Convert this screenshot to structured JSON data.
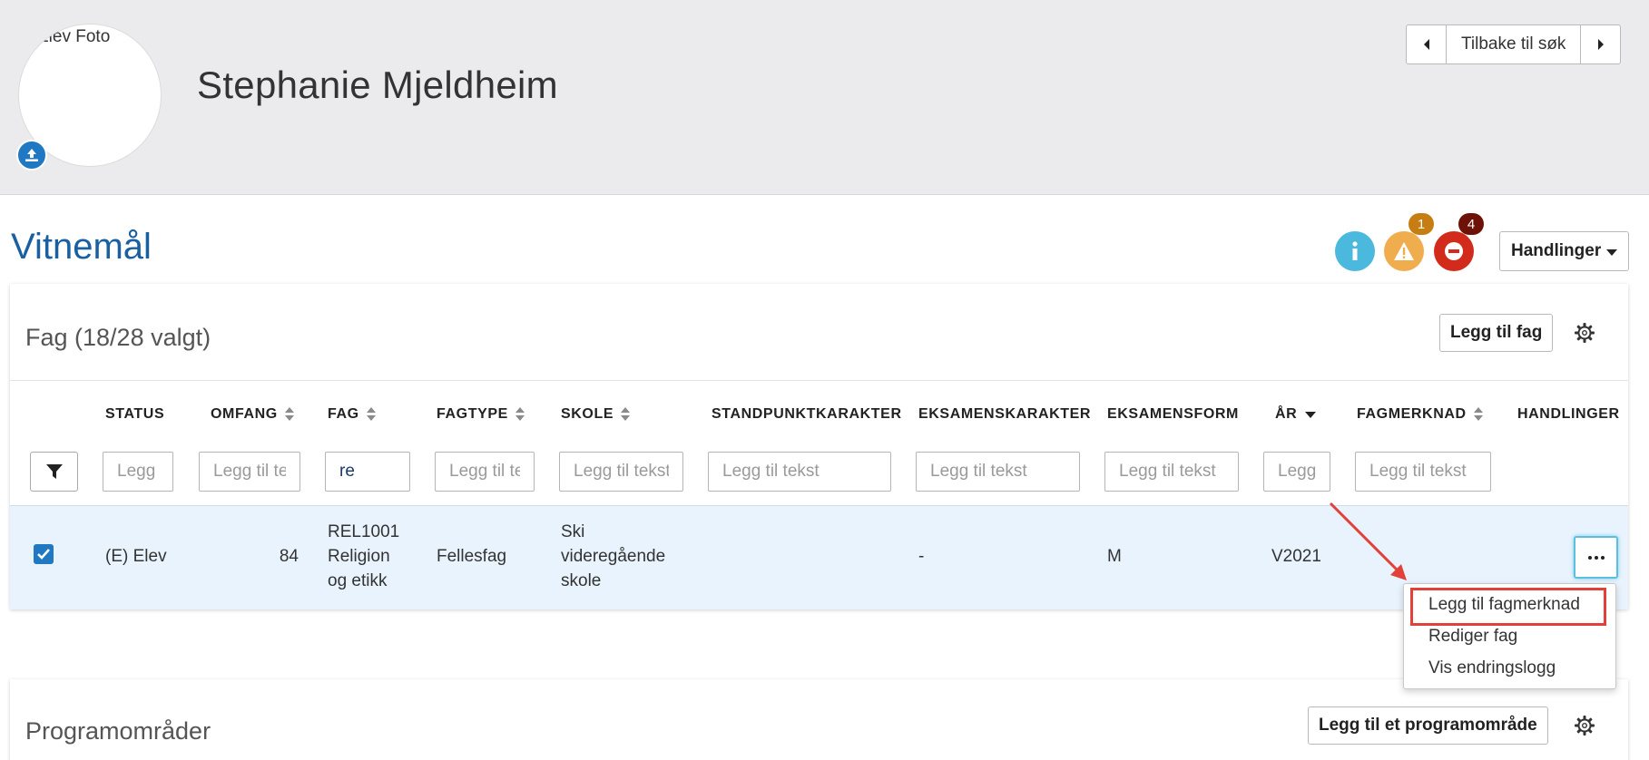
{
  "header": {
    "photo_alt": "Elev Foto",
    "student_name": "Stephanie Mjeldheim",
    "nav": {
      "back_label": "Tilbake til søk"
    }
  },
  "page": {
    "title": "Vitnemål",
    "warning_count": "1",
    "error_count": "4",
    "actions_label": "Handlinger"
  },
  "fag_card": {
    "title": "Fag (18/28 valgt)",
    "add_button": "Legg til fag",
    "columns": [
      "STATUS",
      "OMFANG",
      "FAG",
      "FAGTYPE",
      "SKOLE",
      "STANDPUNKTKARAKTER",
      "EKSAMENSKARAKTER",
      "EKSAMENSFORM",
      "ÅR",
      "FAGMERKNAD",
      "HANDLINGER"
    ],
    "filters": {
      "status": {
        "placeholder": "Legg til tekst",
        "value": ""
      },
      "omfang": {
        "placeholder": "Legg til tekst",
        "value": ""
      },
      "fag": {
        "placeholder": "Legg til tekst",
        "value": "re"
      },
      "fagtype": {
        "placeholder": "Legg til tekst",
        "value": ""
      },
      "skole": {
        "placeholder": "Legg til tekst",
        "value": ""
      },
      "standpunkt": {
        "placeholder": "Legg til tekst",
        "value": ""
      },
      "eksamenskarakter": {
        "placeholder": "Legg til tekst",
        "value": ""
      },
      "eksamensform": {
        "placeholder": "Legg til tekst",
        "value": ""
      },
      "ar": {
        "placeholder": "Legg til tekst",
        "value": ""
      },
      "fagmerknad": {
        "placeholder": "Legg til tekst",
        "value": ""
      }
    },
    "row": {
      "status": "(E) Elev",
      "omfang": "84",
      "fag_line1": "REL1001",
      "fag_line2": "Religion",
      "fag_line3": "og etikk",
      "fagtype": "Fellesfag",
      "skole_line1": "Ski",
      "skole_line2": "videregående",
      "skole_line3": "skole",
      "standpunkt": "",
      "eksamenskarakter": "-",
      "eksamensform": "M",
      "ar": "V2021",
      "fagmerknad": ""
    },
    "row_menu": {
      "items": [
        "Legg til fagmerknad",
        "Rediger fag",
        "Vis endringslogg"
      ],
      "highlighted": "Legg til fagmerknad"
    }
  },
  "program_card": {
    "title": "Programområder",
    "add_button": "Legg til et programområde"
  },
  "colors": {
    "header_bg": "#ebebed",
    "title_blue": "#1a5fa0",
    "primary": "#1f78c1",
    "info": "#4bb9de",
    "warning": "#f0ad4e",
    "danger": "#d22b1b",
    "row_selected": "#e9f3fd",
    "annotation": "#e2413a"
  }
}
